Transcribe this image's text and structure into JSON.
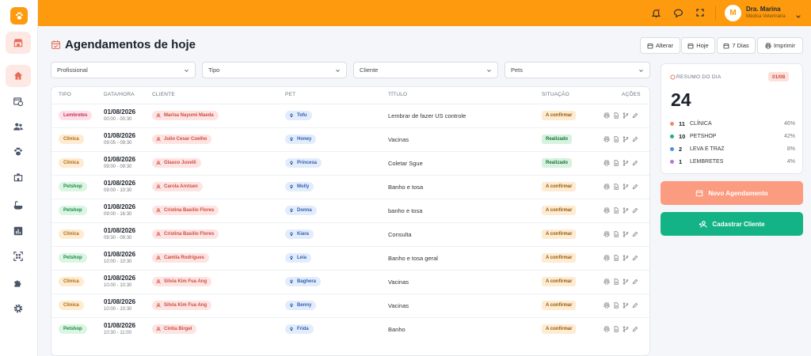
{
  "user": {
    "initial": "M",
    "name": "Dra. Marina",
    "role": "Médica Veterinária"
  },
  "page": {
    "title": "Agendamentos de hoje"
  },
  "toolbar": {
    "alterar": "Alterar",
    "hoje": "Hoje",
    "dias7": "7 Dias",
    "imprimir": "Imprimir"
  },
  "filters": {
    "profissional": "Profissional",
    "tipo": "Tipo",
    "cliente": "Cliente",
    "pets": "Pets"
  },
  "table": {
    "headers": {
      "tipo": "TIPO",
      "data": "DATA/HORA",
      "cliente": "CLIENTE",
      "pet": "PET",
      "titulo": "TÍTULO",
      "situacao": "SITUAÇÃO",
      "acoes": "AÇÕES"
    },
    "rows": [
      {
        "tipo": "Lembretes",
        "kind": "lemb",
        "date": "01/08/2026",
        "time": "00:00 - 00:30",
        "client": "Marisa Nayumi Maeda",
        "pet": "Tofu",
        "title": "Lembrar de fazer US controle",
        "status": "A confirmar",
        "st": "conf"
      },
      {
        "tipo": "Clinica",
        "kind": "clin",
        "date": "01/08/2026",
        "time": "09:05 - 09:30",
        "client": "Julio Cesar Coelho",
        "pet": "Honey",
        "title": "Vacinas",
        "status": "Realizado",
        "st": "real"
      },
      {
        "tipo": "Clinica",
        "kind": "clin",
        "date": "01/08/2026",
        "time": "09:00 - 09:30",
        "client": "Glauco Juvelli",
        "pet": "Princesa",
        "title": "Coletar Sgue",
        "status": "Realizado",
        "st": "real"
      },
      {
        "tipo": "Petshop",
        "kind": "pet",
        "date": "01/08/2026",
        "time": "09:00 - 10:30",
        "client": "Carola Arntsen",
        "pet": "Molly",
        "title": "Banho e tosa",
        "status": "A confirmar",
        "st": "conf"
      },
      {
        "tipo": "Petshop",
        "kind": "pet",
        "date": "01/08/2026",
        "time": "09:00 - 16:30",
        "client": "Cristina Basilio Flores",
        "pet": "Donna",
        "title": "banho e tosa",
        "status": "A confirmar",
        "st": "conf"
      },
      {
        "tipo": "Clinica",
        "kind": "clin",
        "date": "01/08/2026",
        "time": "09:30 - 09:30",
        "client": "Cristina Basilio Flores",
        "pet": "Kiara",
        "title": "Consulta",
        "status": "A confirmar",
        "st": "conf"
      },
      {
        "tipo": "Petshop",
        "kind": "pet",
        "date": "01/08/2026",
        "time": "10:00 - 10:30",
        "client": "Camila Rodrigues",
        "pet": "Leia",
        "title": "Banho e tosa geral",
        "status": "A confirmar",
        "st": "conf"
      },
      {
        "tipo": "Clinica",
        "kind": "clin",
        "date": "01/08/2026",
        "time": "10:00 - 10:30",
        "client": "Silvia Kim Fua Ang",
        "pet": "Baghera",
        "title": "Vacinas",
        "status": "A confirmar",
        "st": "conf"
      },
      {
        "tipo": "Clinica",
        "kind": "clin",
        "date": "01/08/2026",
        "time": "10:00 - 10:30",
        "client": "Silvia Kim Fua Ang",
        "pet": "Benny",
        "title": "Vacinas",
        "status": "A confirmar",
        "st": "conf"
      },
      {
        "tipo": "Petshop",
        "kind": "pet",
        "date": "01/08/2026",
        "time": "10:30 - 11:00",
        "client": "Cintia Birgel",
        "pet": "Frida",
        "title": "Banho",
        "status": "A confirmar",
        "st": "conf"
      }
    ]
  },
  "summary": {
    "title": "RESUMO DO DIA",
    "date": "01/08",
    "total": "24",
    "items": [
      {
        "count": "11",
        "label": "CLÍNICA",
        "pct": "46%",
        "color": "#f08a6a"
      },
      {
        "count": "10",
        "label": "PETSHOP",
        "pct": "42%",
        "color": "#1fb27a"
      },
      {
        "count": "2",
        "label": "LEVA E TRAZ",
        "pct": "8%",
        "color": "#4a8fe0"
      },
      {
        "count": "1",
        "label": "LEMBRETES",
        "pct": "4%",
        "color": "#b07ad8"
      }
    ]
  },
  "actions": {
    "novo": "Novo Agendamento",
    "cadastrar": "Cadastrar Cliente"
  },
  "colors": {
    "brand": "#fd9a0d",
    "novo": "#fb9b7f",
    "cadastrar": "#13b386"
  }
}
